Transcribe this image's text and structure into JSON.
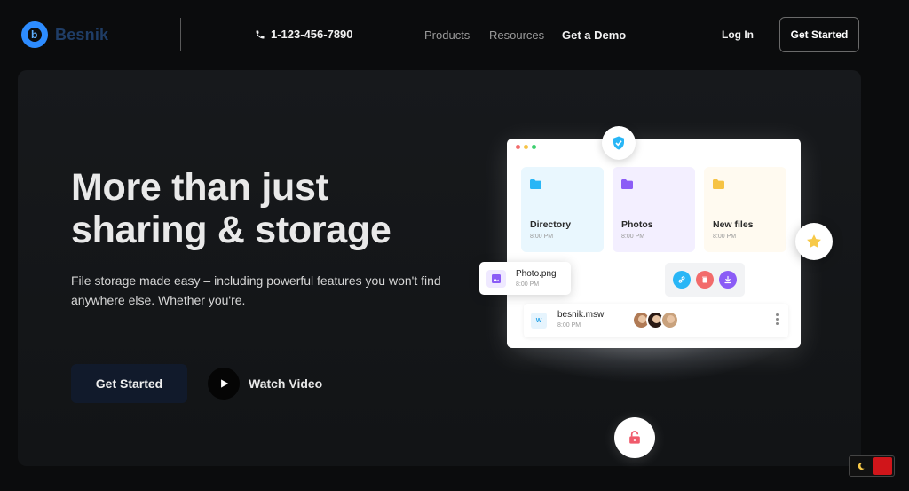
{
  "nav": {
    "logo_text": "Besnik",
    "phone": "1-123-456-7890",
    "links": [
      "Products",
      "Resources",
      "Get a Demo"
    ],
    "login": "Log In",
    "cta": "Get Started"
  },
  "hero": {
    "title_line1": "More than just",
    "title_line2": "sharing & storage",
    "subtitle": "File storage made easy – including powerful features you won't find anywhere else. Whether you're.",
    "primary_cta": "Get Started",
    "secondary_cta": "Watch Video"
  },
  "card": {
    "folders": [
      {
        "name": "Directory",
        "time": "8:00 PM",
        "color": "#29b6f6",
        "bg": "#e9f7fe"
      },
      {
        "name": "Photos",
        "time": "8:00 PM",
        "color": "#8b5cf6",
        "bg": "#f3efff"
      },
      {
        "name": "New files",
        "time": "8:00 PM",
        "color": "#f6c344",
        "bg": "#fffaf0"
      }
    ],
    "photo_file": {
      "name": "Photo.png",
      "time": "8:00 PM"
    },
    "doc_file": {
      "name": "besnik.msw",
      "time": "8:00 PM",
      "icon_letter": "W"
    }
  },
  "colors": {
    "accent_blue": "#2d8cff",
    "link_action": "#29b6f6",
    "delete_action": "#f26b6b",
    "download_action": "#8b5cf6",
    "star": "#f7c948",
    "lock": "#f05a6b"
  }
}
